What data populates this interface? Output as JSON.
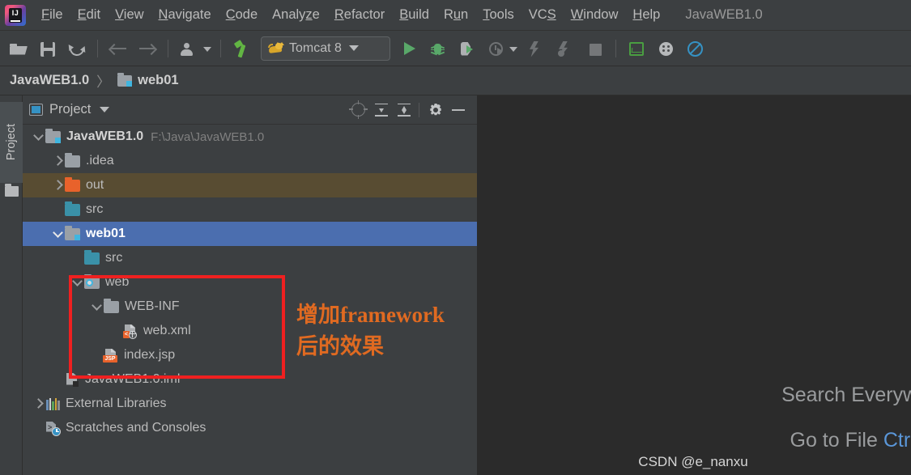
{
  "menu": {
    "items": [
      {
        "label": "File",
        "mnemonic": "F"
      },
      {
        "label": "Edit",
        "mnemonic": "E"
      },
      {
        "label": "View",
        "mnemonic": "V"
      },
      {
        "label": "Navigate",
        "mnemonic": "N"
      },
      {
        "label": "Code",
        "mnemonic": "C"
      },
      {
        "label": "Analyze",
        "mnemonic": "y"
      },
      {
        "label": "Refactor",
        "mnemonic": "R"
      },
      {
        "label": "Build",
        "mnemonic": "B"
      },
      {
        "label": "Run",
        "mnemonic": "u"
      },
      {
        "label": "Tools",
        "mnemonic": "T"
      },
      {
        "label": "VCS",
        "mnemonic": "S"
      },
      {
        "label": "Window",
        "mnemonic": "W"
      },
      {
        "label": "Help",
        "mnemonic": "H"
      }
    ],
    "project_title": "JavaWEB1.0",
    "app_logo": "intellij-idea-logo"
  },
  "toolbar": {
    "icons": [
      "open-folder-icon",
      "save-all-icon",
      "refresh-icon",
      "navigate-back-icon",
      "navigate-forward-icon",
      "version-control-user-icon",
      "build-hammer-icon"
    ],
    "run_config": {
      "label": "Tomcat 8",
      "icon": "tomcat-cat-icon",
      "dropdown": "chevron-down-icon"
    },
    "run_icons": [
      "run-icon",
      "debug-icon",
      "run-with-coverage-icon",
      "profiler-icon",
      "update-application-icon",
      "redeploy-icon",
      "stop-icon",
      "monitor-icon",
      "dots-circle-icon",
      "no-entry-icon"
    ]
  },
  "breadcrumb": {
    "project": "JavaWEB1.0",
    "separator": "〉",
    "module": "web01",
    "module_icon": "module-icon"
  },
  "stripe": {
    "project_tab": "Project",
    "folder_icon": "folder-icon"
  },
  "panel": {
    "title": "Project",
    "title_icon": "project-view-icon",
    "dropdown_icon": "chevron-down-icon",
    "actions": [
      "select-opened-file-icon",
      "expand-all-icon",
      "collapse-all-icon",
      "settings-gear-icon",
      "hide-panel-icon"
    ]
  },
  "tree": [
    {
      "label": "JavaWEB1.0",
      "path": "F:\\Java\\JavaWEB1.0",
      "icon": "project-module-folder-icon",
      "indent": 0,
      "chevron": "down",
      "bold": true,
      "state": "normal"
    },
    {
      "label": ".idea",
      "icon": "folder-icon-gray",
      "indent": 1,
      "chevron": "right",
      "bold": false,
      "state": "normal"
    },
    {
      "label": "out",
      "icon": "folder-icon-excluded",
      "indent": 1,
      "chevron": "right",
      "bold": false,
      "state": "excluded"
    },
    {
      "label": "src",
      "icon": "folder-icon-sources",
      "indent": 1,
      "chevron": "none",
      "bold": false,
      "state": "normal"
    },
    {
      "label": "web01",
      "icon": "module-folder-icon",
      "indent": 1,
      "chevron": "down",
      "bold": true,
      "state": "selected"
    },
    {
      "label": "src",
      "icon": "folder-icon-sources",
      "indent": 2,
      "chevron": "none",
      "bold": false,
      "state": "normal"
    },
    {
      "label": "web",
      "icon": "web-resource-folder-icon",
      "indent": 2,
      "chevron": "down",
      "bold": false,
      "state": "normal"
    },
    {
      "label": "WEB-INF",
      "icon": "folder-icon-gray",
      "indent": 3,
      "chevron": "down",
      "bold": false,
      "state": "normal"
    },
    {
      "label": "web.xml",
      "icon": "web-xml-file-icon",
      "badge": "<",
      "indent": 4,
      "chevron": "none",
      "bold": false,
      "state": "normal"
    },
    {
      "label": "index.jsp",
      "icon": "jsp-file-icon",
      "badge": "JSP",
      "indent": 3,
      "chevron": "none",
      "bold": false,
      "state": "normal"
    },
    {
      "label": "JavaWEB1.0.iml",
      "icon": "iml-module-file-icon",
      "indent": 1,
      "chevron": "none",
      "bold": false,
      "state": "normal"
    },
    {
      "label": "External Libraries",
      "icon": "external-libraries-icon",
      "indent": 0,
      "chevron": "right",
      "bold": false,
      "state": "normal"
    },
    {
      "label": "Scratches and Consoles",
      "icon": "scratches-consoles-icon",
      "indent": 0,
      "chevron": "none",
      "bold": false,
      "state": "normal"
    }
  ],
  "annotation": {
    "line1": "增加framework",
    "line2": "后的效果",
    "box_color": "#ef2020",
    "text_color": "#e06a21"
  },
  "editor": {
    "hint_search": "Search Everywhe",
    "hint_goto_label": "Go to File",
    "hint_goto_key": "Ctrl+S",
    "watermark": "CSDN @e_nanxu",
    "background": "#2b2b2b"
  },
  "colors": {
    "chrome": "#3c3f41",
    "selection": "#4b6eaf",
    "excluded_row": "#584c32",
    "accent_blue": "#3592c4",
    "run_green": "#59a869",
    "orange": "#e8622b"
  }
}
